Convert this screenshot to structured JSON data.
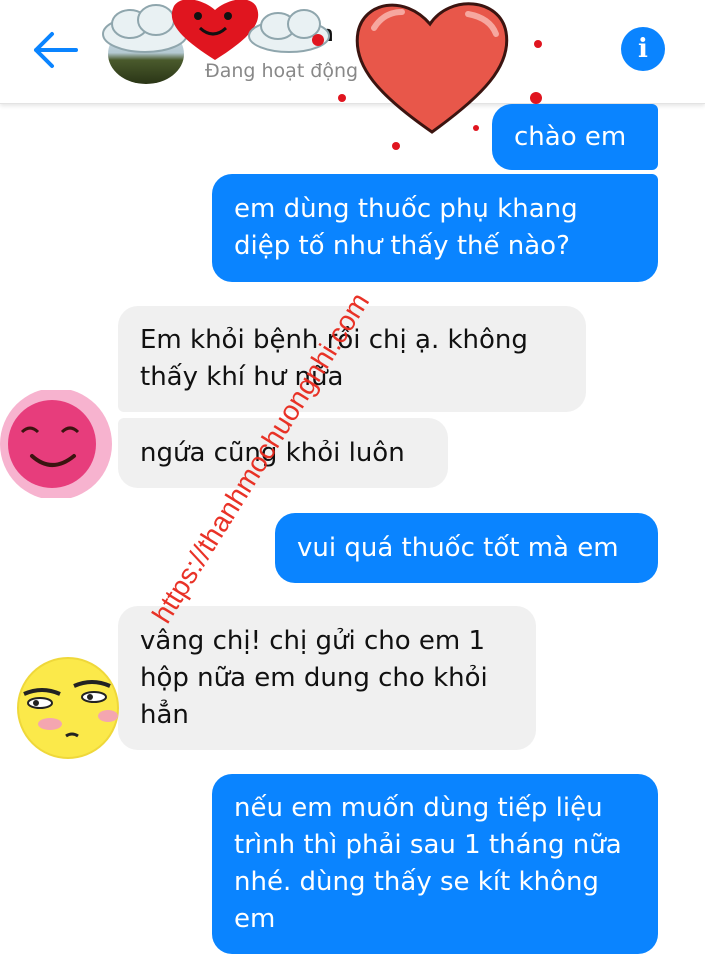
{
  "header": {
    "contact_name": "n",
    "status": "Đang hoạt động",
    "back_icon": "back-arrow-icon",
    "info_icon": "info-icon",
    "info_glyph": "i",
    "accent": "#0a84ff"
  },
  "messages": [
    {
      "dir": "out",
      "text": "chào em"
    },
    {
      "dir": "out",
      "text": "em dùng thuốc phụ khang diệp tố như thấy thế nào?"
    },
    {
      "dir": "in",
      "text": "Em khỏi bệnh rồi chị ạ. không thấy khí hư nữa"
    },
    {
      "dir": "in",
      "text": "ngứa cũng khỏi luôn"
    },
    {
      "dir": "out",
      "text": "vui quá thuốc tốt mà em"
    },
    {
      "dir": "in",
      "text": "vâng chị! chị gửi cho em 1 hộp nữa em dung cho khỏi hẳn"
    },
    {
      "dir": "out",
      "text": "nếu em muốn dùng tiếp liệu trình thì phải sau 1 tháng nữa nhé. dùng thấy se kít không em"
    }
  ],
  "watermark": "https://thanhmochuongnhi.com",
  "colors": {
    "outgoing_bubble": "#0a84ff",
    "incoming_bubble": "#f0f0f0",
    "watermark": "#e8281c"
  }
}
